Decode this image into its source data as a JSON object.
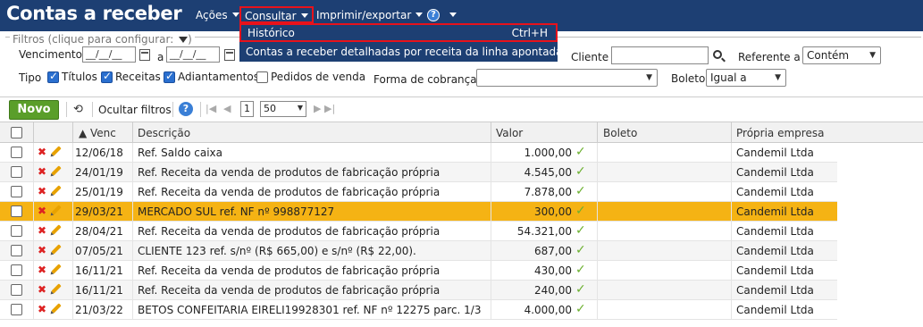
{
  "header": {
    "title": "Contas a receber",
    "menus": {
      "acoes": "Ações",
      "consultar": "Consultar",
      "imprimir": "Imprimir/exportar"
    },
    "help": "?"
  },
  "dropdown": {
    "historico": "Histórico",
    "historico_shortcut": "Ctrl+H",
    "detalhadas": "Contas a receber detalhadas por receita da linha apontada"
  },
  "filters": {
    "legend": "Filtros (clique para configurar:",
    "legend_close": ")",
    "vencimento": "Vencimento",
    "date_from": "__/__/__",
    "a": "a",
    "date_to": "__/__/__",
    "cliente": "Cliente",
    "referente_a": "Referente a",
    "referente_value": "Contém",
    "tipo": "Tipo",
    "titulos": "Títulos",
    "receitas": "Receitas",
    "adiantamentos": "Adiantamentos",
    "pedidos": "Pedidos de venda",
    "forma_cobranca": "Forma de cobrança",
    "boleto": "Boleto",
    "boleto_value": "Igual a"
  },
  "toolbar": {
    "novo": "Novo",
    "ocultar": "Ocultar filtros",
    "page": "1",
    "page_size": "50"
  },
  "table": {
    "headers": {
      "venc": "Venc",
      "descricao": "Descrição",
      "valor": "Valor",
      "boleto": "Boleto",
      "empresa": "Própria empresa"
    },
    "rows": [
      {
        "venc": "12/06/18",
        "descricao": "Ref. Saldo caixa",
        "valor": "1.000,00",
        "empresa": "Candemil Ltda"
      },
      {
        "venc": "24/01/19",
        "descricao": "Ref. Receita da venda de produtos de fabricação própria",
        "valor": "4.545,00",
        "empresa": "Candemil Ltda"
      },
      {
        "venc": "25/01/19",
        "descricao": "Ref. Receita da venda de produtos de fabricação própria",
        "valor": "7.878,00",
        "empresa": "Candemil Ltda"
      },
      {
        "venc": "29/03/21",
        "descricao": "MERCADO SUL ref. NF nº 998877127",
        "valor": "300,00",
        "empresa": "Candemil Ltda"
      },
      {
        "venc": "28/04/21",
        "descricao": "Ref. Receita da venda de produtos de fabricação própria",
        "valor": "54.321,00",
        "empresa": "Candemil Ltda"
      },
      {
        "venc": "07/05/21",
        "descricao": "CLIENTE 123 ref. s/nº (R$ 665,00) e s/nº (R$ 22,00).",
        "valor": "687,00",
        "empresa": "Candemil Ltda"
      },
      {
        "venc": "16/11/21",
        "descricao": "Ref. Receita da venda de produtos de fabricação própria",
        "valor": "430,00",
        "empresa": "Candemil Ltda"
      },
      {
        "venc": "16/11/21",
        "descricao": "Ref. Receita da venda de produtos de fabricação própria",
        "valor": "240,00",
        "empresa": "Candemil Ltda"
      },
      {
        "venc": "21/03/22",
        "descricao": "BETOS CONFEITARIA EIRELI19928301 ref. NF nº 12275 parc. 1/3",
        "valor": "4.000,00",
        "empresa": "Candemil Ltda"
      }
    ]
  },
  "colors": {
    "header_bg": "#1d3f73",
    "selected_row": "#f5b314",
    "highlight_border": "#e8121b",
    "novo_green": "#5a9e2a"
  }
}
